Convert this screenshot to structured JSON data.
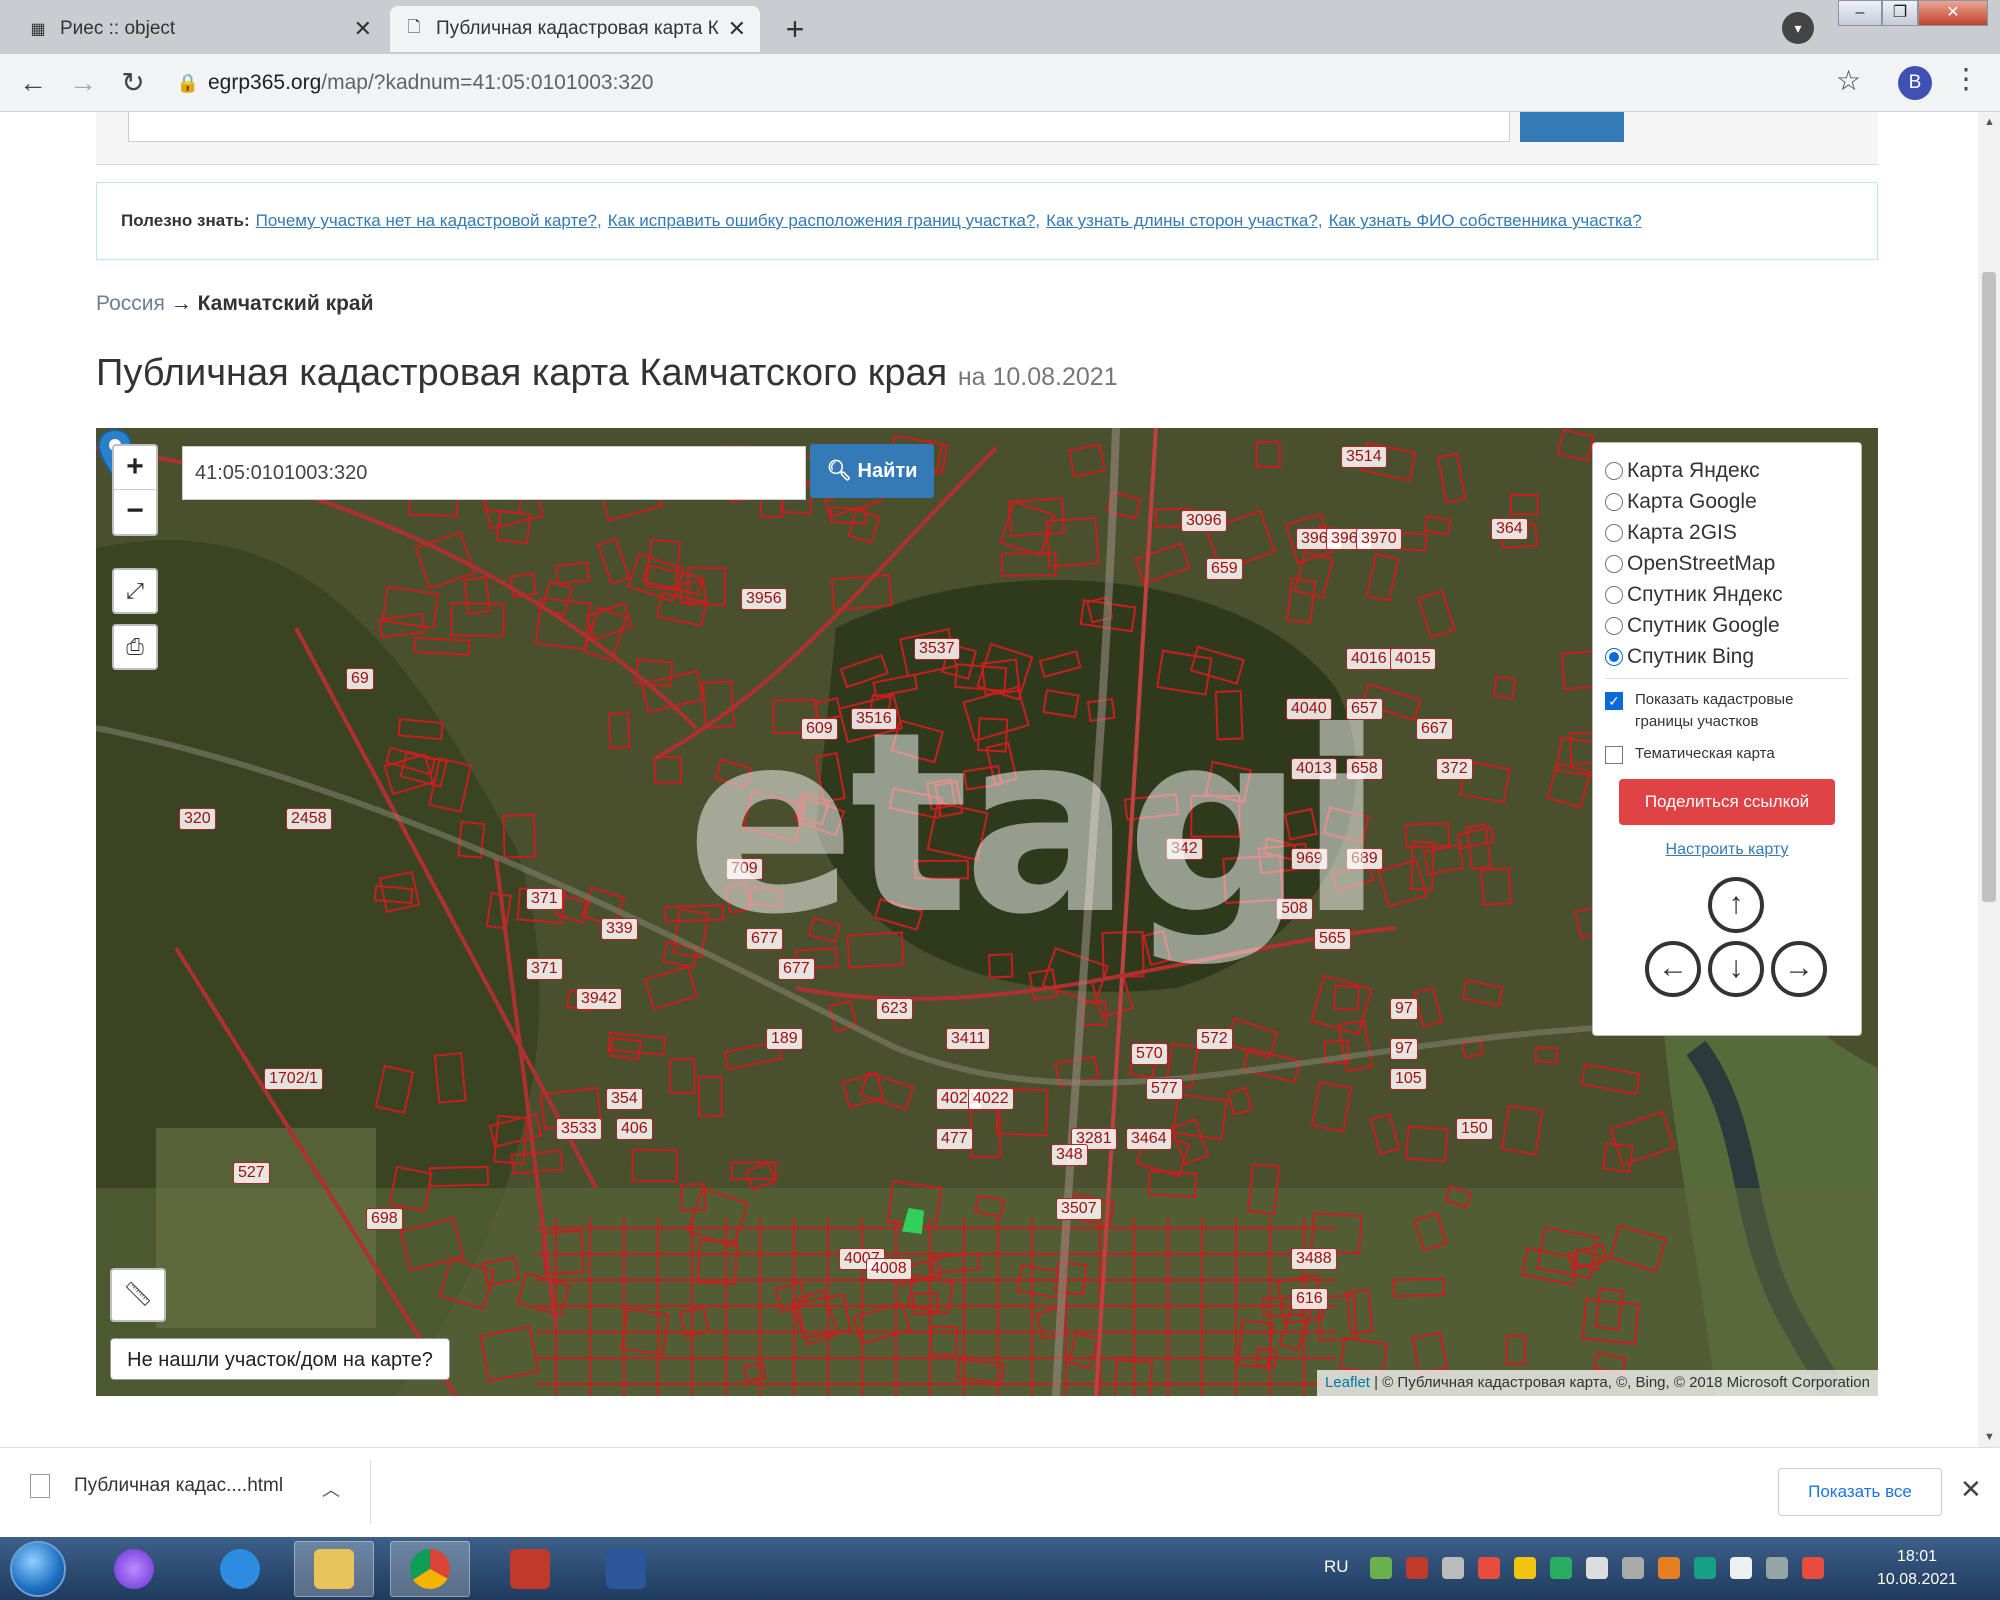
{
  "browser": {
    "tabs": [
      {
        "title": "Риес :: object",
        "close": "✕"
      },
      {
        "title": "Публичная кадастровая карта К",
        "close": "✕"
      }
    ],
    "new_tab": "+",
    "url_domain": "egrp365.org",
    "url_path": "/map/?kadnum=41:05:0101003:320",
    "avatar_letter": "B"
  },
  "useful": {
    "label": "Полезно знать:",
    "links": [
      "Почему участка нет на кадастровой карте?,",
      "Как исправить ошибку расположения границ участка?,",
      "Как узнать длины сторон участка?,",
      "Как узнать ФИО собственника участка?"
    ]
  },
  "breadcrumb": {
    "root": "Россия",
    "sep": "→",
    "current": "Камчатский край"
  },
  "heading": {
    "title": "Публичная кадастровая карта Камчатского края",
    "date": "на 10.08.2021"
  },
  "map": {
    "search_value": "41:05:0101003:320",
    "search_button": "Найти",
    "zoom_in": "+",
    "zoom_out": "−",
    "watermark": "etagi",
    "not_found": "Не нашли участок/дом на карте?",
    "attribution_leaflet": "Leaflet",
    "attribution_rest": " | © Публичная кадастровая карта, ©, Bing, © 2018 Microsoft Corporation",
    "parcel_labels": [
      "3514",
      "3096",
      "659",
      "3968",
      "3969",
      "3970",
      "364",
      "97",
      "3956",
      "3537",
      "69",
      "609",
      "3516",
      "4040",
      "657",
      "4016",
      "4015",
      "667",
      "320",
      "2458",
      "4013",
      "658",
      "372",
      "342",
      "689",
      "969",
      "709",
      "371",
      "339",
      "677",
      "508",
      "565",
      "677",
      "371",
      "3942",
      "623",
      "189",
      "3411",
      "570",
      "572",
      "97",
      "354",
      "4021",
      "4022",
      "577",
      "105",
      "3533",
      "406",
      "477",
      "3281",
      "3464",
      "150",
      "527",
      "348",
      "3507",
      "698",
      "4007",
      "4008",
      "3488",
      "616",
      "1702/1"
    ],
    "layers": [
      "Карта Яндекс",
      "Карта Google",
      "Карта 2GIS",
      "OpenStreetMap",
      "Спутник Яндекс",
      "Спутник Google",
      "Спутник Bing"
    ],
    "selected_layer": 6,
    "show_borders": "Показать кадастровые границы участков",
    "thematic": "Тематическая карта",
    "share": "Поделиться ссылкой",
    "tune": "Настроить карту"
  },
  "downloads": {
    "file": "Публичная кадас....html",
    "show_all": "Показать все"
  },
  "taskbar": {
    "lang": "RU",
    "time": "18:01",
    "date": "10.08.2021"
  },
  "colors": {
    "accent": "#337ab7",
    "share": "#e04346",
    "parcel": "#c81e1e"
  }
}
